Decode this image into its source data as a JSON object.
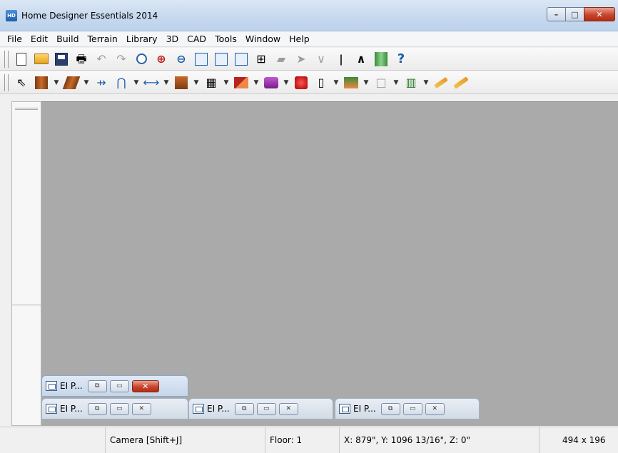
{
  "window": {
    "title": "Home Designer Essentials 2014",
    "app_icon_text": "HD",
    "controls": {
      "minimize": "–",
      "maximize": "□",
      "close": "✕"
    }
  },
  "menu": {
    "items": [
      {
        "label": "File",
        "id": "file"
      },
      {
        "label": "Edit",
        "id": "edit"
      },
      {
        "label": "Build",
        "id": "build"
      },
      {
        "label": "Terrain",
        "id": "terrain"
      },
      {
        "label": "Library",
        "id": "library"
      },
      {
        "label": "3D",
        "id": "3d"
      },
      {
        "label": "CAD",
        "id": "cad"
      },
      {
        "label": "Tools",
        "id": "tools"
      },
      {
        "label": "Window",
        "id": "window"
      },
      {
        "label": "Help",
        "id": "help"
      }
    ]
  },
  "toolbar_top": {
    "icons": [
      "new-document-icon",
      "open-folder-icon",
      "save-icon",
      "print-icon",
      "undo-icon",
      "redo-icon",
      "zoom-icon",
      "zoom-in-icon",
      "zoom-out-icon",
      "zoom-box-icon",
      "fill-window-icon",
      "fill-window-all-icon",
      "pan-icon",
      "wall-hide-icon",
      "camera-icon",
      "down-arrow-icon",
      "up-floor-icon",
      "up-arrow-icon",
      "library-icon",
      "help-icon"
    ]
  },
  "toolbar_bottom": {
    "icons": [
      "select-objects-icon",
      "wall-tool-icon",
      "rail-tool-icon",
      "break-wall-icon",
      "arc-tool-icon",
      "dimension-tool-icon",
      "cabinet-tool-icon",
      "window-tool-icon",
      "room-tool-icon",
      "stair-tool-icon",
      "fireplace-tool-icon",
      "door-tool-icon",
      "roof-tool-icon",
      "box-tool-icon",
      "fence-tool-icon",
      "text-tool-icon",
      "pencil-tool-icon"
    ]
  },
  "mdi_tabs": [
    {
      "label": "EI P...",
      "active": true
    },
    {
      "label": "EI P...",
      "active": false
    },
    {
      "label": "EI P...",
      "active": false
    },
    {
      "label": "EI P...",
      "active": false
    }
  ],
  "status": {
    "mode": "Camera [Shift+J]",
    "floor": "Floor: 1",
    "coords": "X: 879\", Y: 1096 13/16\", Z: 0\"",
    "size": "494 x 196"
  },
  "colors": {
    "workspace": "#aaaaaa",
    "titlebar": "#c5d8ee",
    "close_red": "#c8452c"
  }
}
